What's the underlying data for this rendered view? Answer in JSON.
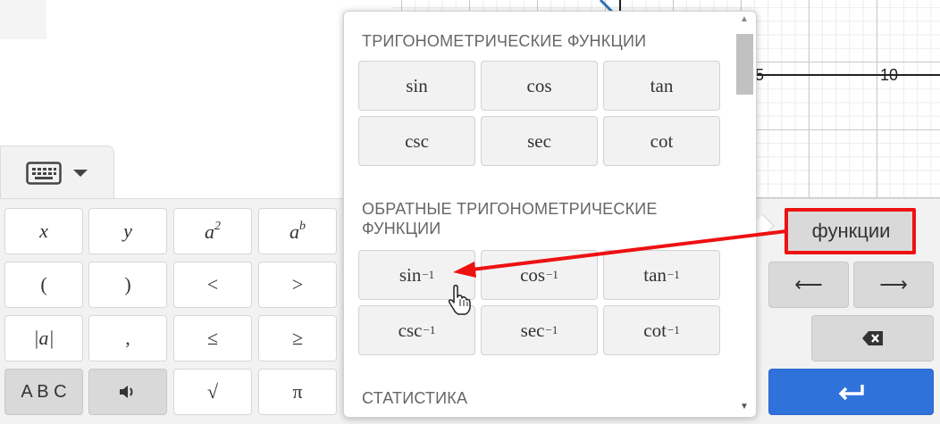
{
  "graph": {
    "tick_labels": [
      "5",
      "10"
    ]
  },
  "keyboard": {
    "toggle_icons": [
      "keyboard-icon",
      "caret-down-icon"
    ],
    "main_keys": [
      [
        "x",
        "y",
        "a²",
        "aᵇ"
      ],
      [
        "(",
        ")",
        "<",
        ">"
      ],
      [
        "|a|",
        ",",
        "≤",
        "≥"
      ],
      [
        "A B C",
        "speaker-icon",
        "√",
        "π"
      ]
    ],
    "functions_label": "функции",
    "nav_keys": [
      "⟵",
      "⟶"
    ],
    "backspace_icon": "backspace-icon",
    "enter_icon": "enter-icon",
    "enter_color": "#2f72dc"
  },
  "popup": {
    "sections": [
      {
        "title": "ТРИГОНОМЕТРИЧЕСКИЕ ФУНКЦИИ",
        "items": [
          "sin",
          "cos",
          "tan",
          "csc",
          "sec",
          "cot"
        ]
      },
      {
        "title": "ОБРАТНЫЕ ТРИГОНОМЕТРИЧЕСКИЕ ФУНКЦИИ",
        "items": [
          "sin",
          "cos",
          "tan",
          "csc",
          "sec",
          "cot"
        ],
        "superscript": "−1"
      },
      {
        "title": "СТАТИСТИКА",
        "items": []
      }
    ]
  },
  "annotation": {
    "highlight_color": "#ee1111",
    "arrow_from": "функции",
    "arrow_to": "sin⁻¹"
  }
}
